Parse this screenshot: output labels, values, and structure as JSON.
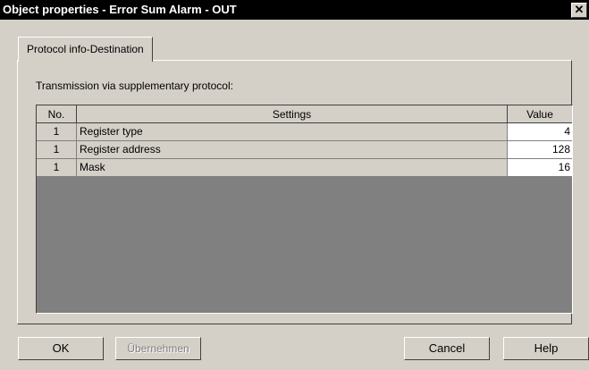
{
  "window": {
    "title": "Object properties - Error Sum Alarm - OUT",
    "close_label": "✕"
  },
  "tabs": [
    {
      "label": "Protocol info-Destination",
      "active": true
    }
  ],
  "caption": "Transmission via supplementary protocol:",
  "table": {
    "columns": [
      "No.",
      "Settings",
      "Value"
    ],
    "rows": [
      {
        "no": "1",
        "setting": "Register type",
        "value": "4"
      },
      {
        "no": "1",
        "setting": "Register address",
        "value": "128"
      },
      {
        "no": "1",
        "setting": "Mask",
        "value": "16"
      }
    ]
  },
  "buttons": {
    "ok": "OK",
    "apply": "Übernehmen",
    "cancel": "Cancel",
    "help": "Help"
  }
}
